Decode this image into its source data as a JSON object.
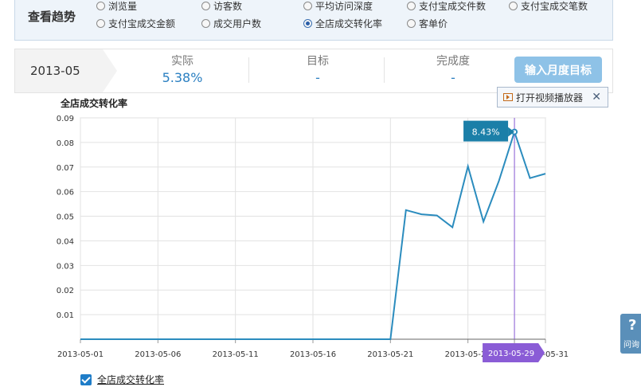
{
  "trend": {
    "title": "查看趋势",
    "options": [
      {
        "label": "浏览量",
        "checked": false
      },
      {
        "label": "访客数",
        "checked": false
      },
      {
        "label": "平均访问深度",
        "checked": false
      },
      {
        "label": "支付宝成交件数",
        "checked": false
      },
      {
        "label": "支付宝成交笔数",
        "checked": false
      },
      {
        "label": "支付宝成交金额",
        "checked": false
      },
      {
        "label": "成交用户数",
        "checked": false
      },
      {
        "label": "全店成交转化率",
        "checked": true
      },
      {
        "label": "客单价",
        "checked": false
      }
    ]
  },
  "stats": {
    "month": "2013-05",
    "actual_label": "实际",
    "actual_value": "5.38%",
    "target_label": "目标",
    "target_value": "-",
    "completion_label": "完成度",
    "completion_value": "-",
    "target_button": "输入月度目标"
  },
  "video": {
    "label": "打开视频播放器",
    "close": "✕",
    "icon": "video-player-icon"
  },
  "help": {
    "glyph": "?",
    "label": "问询"
  },
  "chart_data": {
    "type": "line",
    "title": "全店成交转化率",
    "x_tick_labels": [
      "2013-05-01",
      "2013-05-06",
      "2013-05-11",
      "2013-05-16",
      "2013-05-21",
      "2013-05-26",
      "2013-05-29",
      "2013-05-31"
    ],
    "x": [
      "2013-05-01",
      "2013-05-02",
      "2013-05-03",
      "2013-05-04",
      "2013-05-05",
      "2013-05-06",
      "2013-05-07",
      "2013-05-08",
      "2013-05-09",
      "2013-05-10",
      "2013-05-11",
      "2013-05-12",
      "2013-05-13",
      "2013-05-14",
      "2013-05-15",
      "2013-05-16",
      "2013-05-17",
      "2013-05-18",
      "2013-05-19",
      "2013-05-20",
      "2013-05-21",
      "2013-05-22",
      "2013-05-23",
      "2013-05-24",
      "2013-05-25",
      "2013-05-26",
      "2013-05-27",
      "2013-05-28",
      "2013-05-29",
      "2013-05-30",
      "2013-05-31"
    ],
    "y": [
      0,
      0,
      0,
      0,
      0,
      0,
      0,
      0,
      0,
      0,
      0,
      0,
      0,
      0,
      0,
      0,
      0,
      0,
      0,
      0,
      0,
      0.0525,
      0.0508,
      0.0503,
      0.0455,
      0.0703,
      0.0478,
      0.0644,
      0.0843,
      0.0655,
      0.0673
    ],
    "ylim": [
      0,
      0.09
    ],
    "y_ticks": [
      "0.01",
      "0.02",
      "0.03",
      "0.04",
      "0.05",
      "0.06",
      "0.07",
      "0.08",
      "0.09"
    ],
    "grid": true,
    "legend_label": "全店成交转化率",
    "tooltip_label": "8.43%",
    "highlight_date": "2013-05-29",
    "highlight_label": "2013-05-29",
    "line_color": "#2b8cbe",
    "marker_color": "#8a5cd6",
    "tooltip_bg": "#1b7fa8"
  }
}
